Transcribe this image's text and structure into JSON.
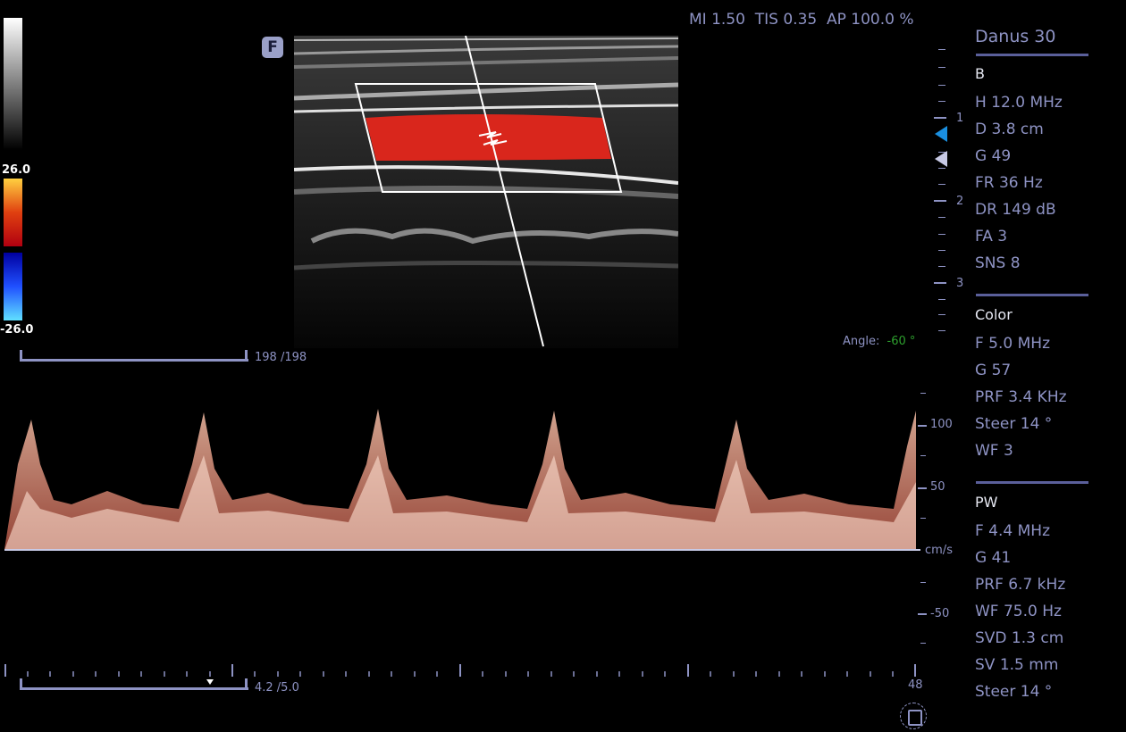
{
  "header": {
    "mi": "MI 1.50",
    "tis": "TIS 0.35",
    "ap": "AP 100.0 %"
  },
  "color_bar": {
    "max": "26.0",
    "min": "-26.0"
  },
  "frame_badge": "F",
  "cine_counter": "198 /198",
  "angle": {
    "label": "Angle:",
    "value": "-60 °"
  },
  "depth_scale": {
    "labels": [
      "1",
      "2",
      "3"
    ]
  },
  "velocity_scale": {
    "labels": [
      "100",
      "50",
      "cm/s",
      "-50"
    ]
  },
  "sweep": {
    "counter": "4.2 /5.0",
    "number": "48"
  },
  "panel": {
    "title": "Danus 30",
    "b_mode": {
      "header": "B",
      "items": [
        "H 12.0 MHz",
        "D 3.8 cm",
        "G 49",
        "FR 36 Hz",
        "DR 149 dB",
        "FA 3",
        "SNS 8"
      ]
    },
    "color_mode": {
      "header": "Color",
      "items": [
        "F 5.0 MHz",
        "G 57",
        "PRF 3.4 KHz",
        "Steer 14 °",
        "WF 3"
      ]
    },
    "pw_mode": {
      "header": "PW",
      "items": [
        "F 4.4 MHz",
        "G 41",
        "PRF 6.7 kHz",
        "WF 75.0 Hz",
        "SVD 1.3 cm",
        "SV 1.5 mm",
        "Steer 14 °"
      ]
    }
  },
  "colors": {
    "accent_text": "#8e93c4",
    "separator": "#5a5f9a",
    "angle_value": "#2ea02e",
    "doppler_flow": "#d9261c",
    "spectral": "#f0a890",
    "focus_marker": "#1a8fe0"
  }
}
